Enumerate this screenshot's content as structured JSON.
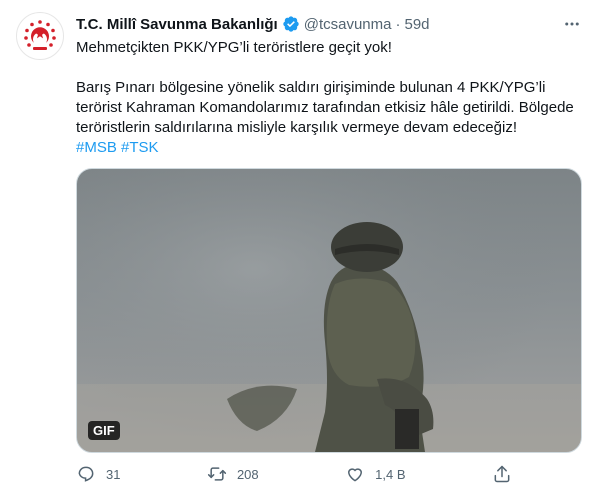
{
  "author": {
    "display_name": "T.C. Millî Savunma Bakanlığı",
    "handle": "@tcsavunma",
    "separator": "·",
    "time": "59d",
    "verified": true
  },
  "tweet": {
    "headline": "Mehmetçikten PKK/YPG’li teröristlere geçit yok!",
    "body": "Barış Pınarı bölgesine yönelik saldırı girişiminde bulunan 4 PKK/YPG’li terörist Kahraman Komandolarımız tarafından etkisiz hâle getirildi. Bölgede teröristlerin saldırılarına misliyle karşılık vermeye devam edeceğiz!",
    "hashtags": [
      "#MSB",
      "#TSK"
    ]
  },
  "media": {
    "badge": "GIF"
  },
  "actions": {
    "reply_count": "31",
    "retweet_count": "208",
    "like_count": "1,4 B"
  },
  "colors": {
    "link": "#1d9bf0",
    "secondary_text": "#536471",
    "verified_badge": "#1d9bf0",
    "logo_red": "#d4202a"
  },
  "icons": {
    "more": "more-icon",
    "reply": "reply-icon",
    "retweet": "retweet-icon",
    "like": "heart-icon",
    "share": "share-icon"
  }
}
